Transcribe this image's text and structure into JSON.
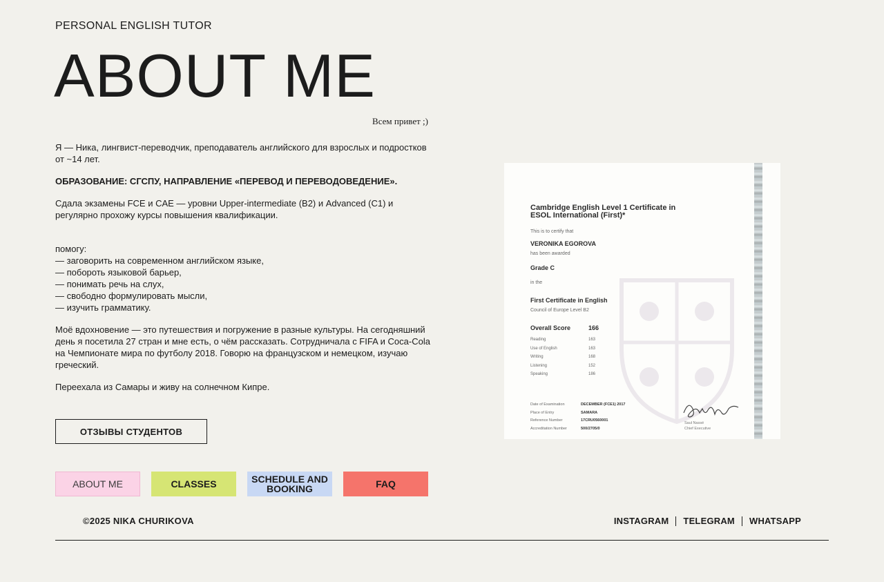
{
  "header": {
    "tagline": "PERSONAL ENGLISH TUTOR",
    "title": "ABOUT ME",
    "greeting": "Всем привет ;)"
  },
  "bio": {
    "intro": "Я — Ника, лингвист-переводчик, преподаватель английского для взрослых и подростков от ~14 лет.",
    "education": "ОБРАЗОВАНИЕ: СГСПУ, НАПРАВЛЕНИЕ «ПЕРЕВОД И ПЕРЕВОДОВЕДЕНИЕ».",
    "exams": "Сдала экзамены FCE и CAE — уровни Upper-intermediate (B2) и Advanced (C1) и регулярно прохожу курсы повышения квалификации.",
    "help_heading": "помогу:",
    "help_items": [
      "— заговорить на современном английском языке,",
      "— побороть языковой барьер,",
      "— понимать речь на слух,",
      "— свободно формулировать мысли,",
      "— изучить грамматику."
    ],
    "inspiration": "Моё вдохновение — это путешествия и погружение в разные культуры. На сегодняшний день я посетила 27 стран и мне есть, о чём рассказать. Сотрудничала с FIFA и Coca-Cola на Чемпионате мира по футболу 2018. Говорю на французском и немецком, изучаю греческий.",
    "relocation": "Переехала из Самары и живу на солнечном Кипре."
  },
  "reviews_button": "ОТЗЫВЫ СТУДЕНТОВ",
  "nav": {
    "about": "ABOUT ME",
    "classes": "CLASSES",
    "schedule": "SCHEDULE AND BOOKING",
    "faq": "FAQ"
  },
  "footer": {
    "copyright": "©2025 NIKA CHURIKOVA",
    "social": [
      "INSTAGRAM",
      "TELEGRAM",
      "WHATSAPP"
    ]
  },
  "certificate": {
    "heading": "Cambridge English Level 1 Certificate in ESOL International (First)*",
    "certify": "This is to certify that",
    "name": "VERONIKA EGOROVA",
    "awarded": "has been awarded",
    "grade": "Grade C",
    "in_the": "in the",
    "qualification": "First Certificate in English",
    "level": "Council of Europe Level B2",
    "overall_label": "Overall Score",
    "overall_value": "166",
    "scores": [
      {
        "label": "Reading",
        "value": "163"
      },
      {
        "label": "Use of English",
        "value": "163"
      },
      {
        "label": "Writing",
        "value": "168"
      },
      {
        "label": "Listening",
        "value": "152"
      },
      {
        "label": "Speaking",
        "value": "186"
      }
    ],
    "details": [
      {
        "label": "Date of Examination",
        "value": "DECEMBER (FCE1) 2017"
      },
      {
        "label": "Place of Entry",
        "value": "SAMARA"
      },
      {
        "label": "Reference Number",
        "value": "17CRU0560001"
      },
      {
        "label": "Accreditation Number",
        "value": "500/2705/0"
      }
    ],
    "signatory": "Saul Nassé",
    "signatory_role": "Chief Executive"
  },
  "colors": {
    "background": "#f2f1ec",
    "about_pink": "#fbd3e6",
    "classes_lime": "#d6e574",
    "schedule_blue": "#c8d8f4",
    "faq_coral": "#f5746b"
  }
}
